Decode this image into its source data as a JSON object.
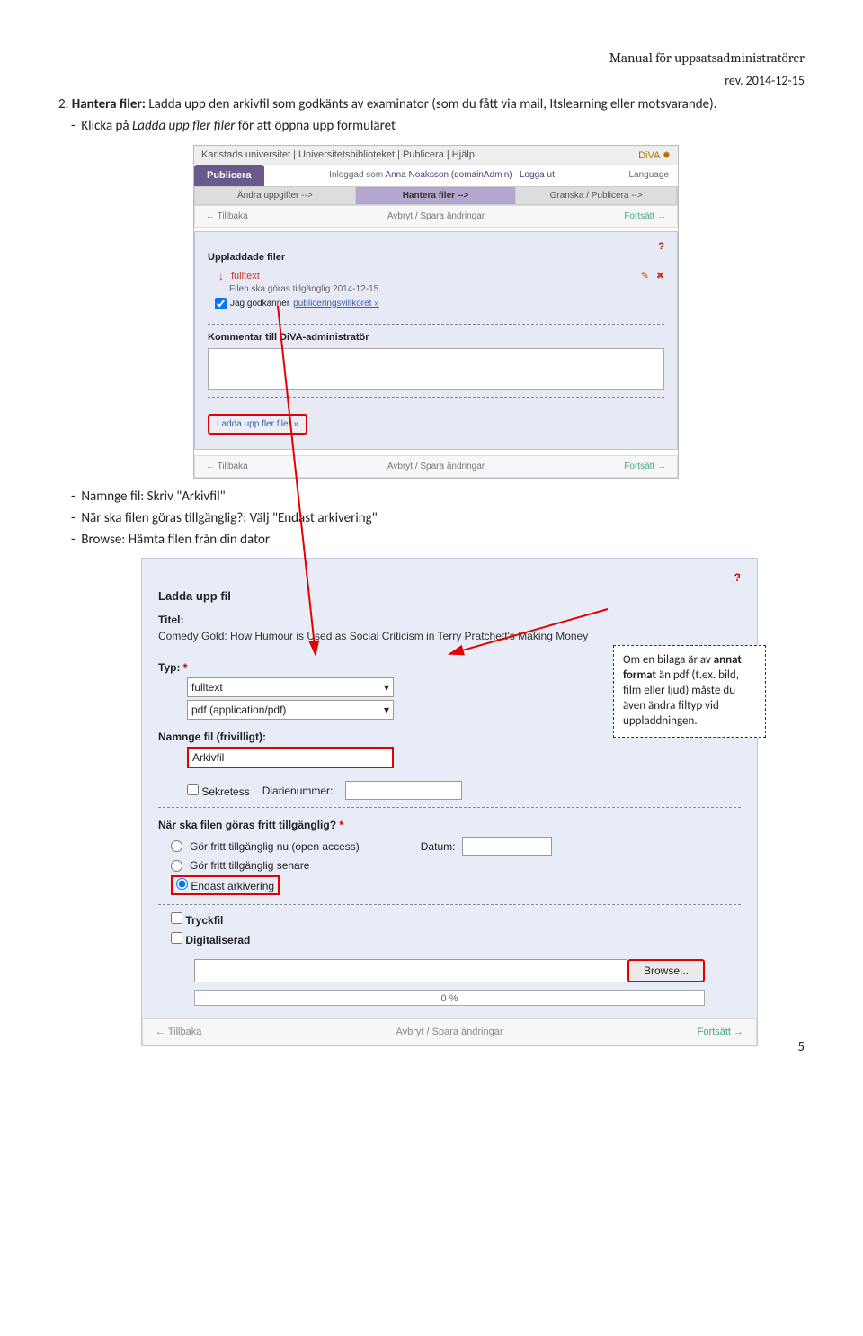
{
  "header": {
    "title": "Manual för uppsatsadministratörer",
    "rev": "rev. 2014-12-15"
  },
  "intro": {
    "num": "2. ",
    "bold": "Hantera filer:",
    "rest": " Ladda upp den arkivfil som godkänts av examinator (som du fått via mail, Itslearning eller motsvarande).",
    "bullet1a": "Klicka på ",
    "bullet1b": "Ladda upp fler filer",
    "bullet1c": " för att öppna upp formuläret"
  },
  "s1": {
    "topnav": "Karlstads universitet  |  Universitetsbiblioteket  |  Publicera  |  Hjälp",
    "diva": "DiVA",
    "tab": "Publicera",
    "login_pre": "Inloggad som ",
    "login_user": "Anna Noaksson (domainAdmin)",
    "logout": "Logga ut",
    "lang": "Language",
    "tabs": {
      "t1": "Ändra uppgifter -->",
      "t2": "Hantera filer -->",
      "t3": "Granska / Publicera -->"
    },
    "nav": {
      "back": "←  Tillbaka",
      "mid": "Avbryt / Spara ändringar",
      "fwd": "Fortsätt  →"
    },
    "q": "?",
    "h_upl": "Uppladdade filer",
    "file": "fulltext",
    "file_sub": "Filen ska göras tillgänglig 2014-12-15.",
    "accept_pre": "Jag godkänner ",
    "accept_link": "publiceringsvillkoret »",
    "h_comment": "Kommentar till DiVA-administratör",
    "upload_more": "Ladda upp fler filer »"
  },
  "mid": {
    "b1": "Namnge fil: Skriv \"Arkivfil\"",
    "b2": "När ska filen göras tillgänglig?: Välj \"Endast arkivering\"",
    "b3": "Browse: Hämta filen från din dator"
  },
  "s2": {
    "q": "?",
    "h": "Ladda upp fil",
    "l_title": "Titel:",
    "title_text": "Comedy Gold: How Humour is Used as Social Criticism in Terry Pratchett's Making Money",
    "l_typ": "Typ: ",
    "star": "*",
    "sel1": "fulltext",
    "sel2": "pdf (application/pdf)",
    "l_namnge": "Namnge fil (frivilligt):",
    "name_val": "Arkivfil",
    "sekretess": "Sekretess",
    "diarie": "Diarienummer:",
    "l_when": "När ska filen göras fritt tillgänglig? ",
    "r1": "Gör fritt tillgänglig nu (open access)",
    "r2": "Gör fritt tillgänglig senare",
    "r3": "Endast arkivering",
    "datum": "Datum:",
    "tryck": "Tryckfil",
    "digi": "Digitaliserad",
    "browse": "Browse...",
    "progress": "0 %",
    "nav": {
      "back": "←  Tillbaka",
      "mid": "Avbryt / Spara ändringar",
      "fwd": "Fortsätt  →"
    }
  },
  "callout": {
    "l1": "Om en bilaga är av ",
    "l2": "annat format",
    "l3": " än pdf (t.ex. bild, film eller ljud) måste du även ändra filtyp vid uppladdningen."
  },
  "pagenum": "5"
}
